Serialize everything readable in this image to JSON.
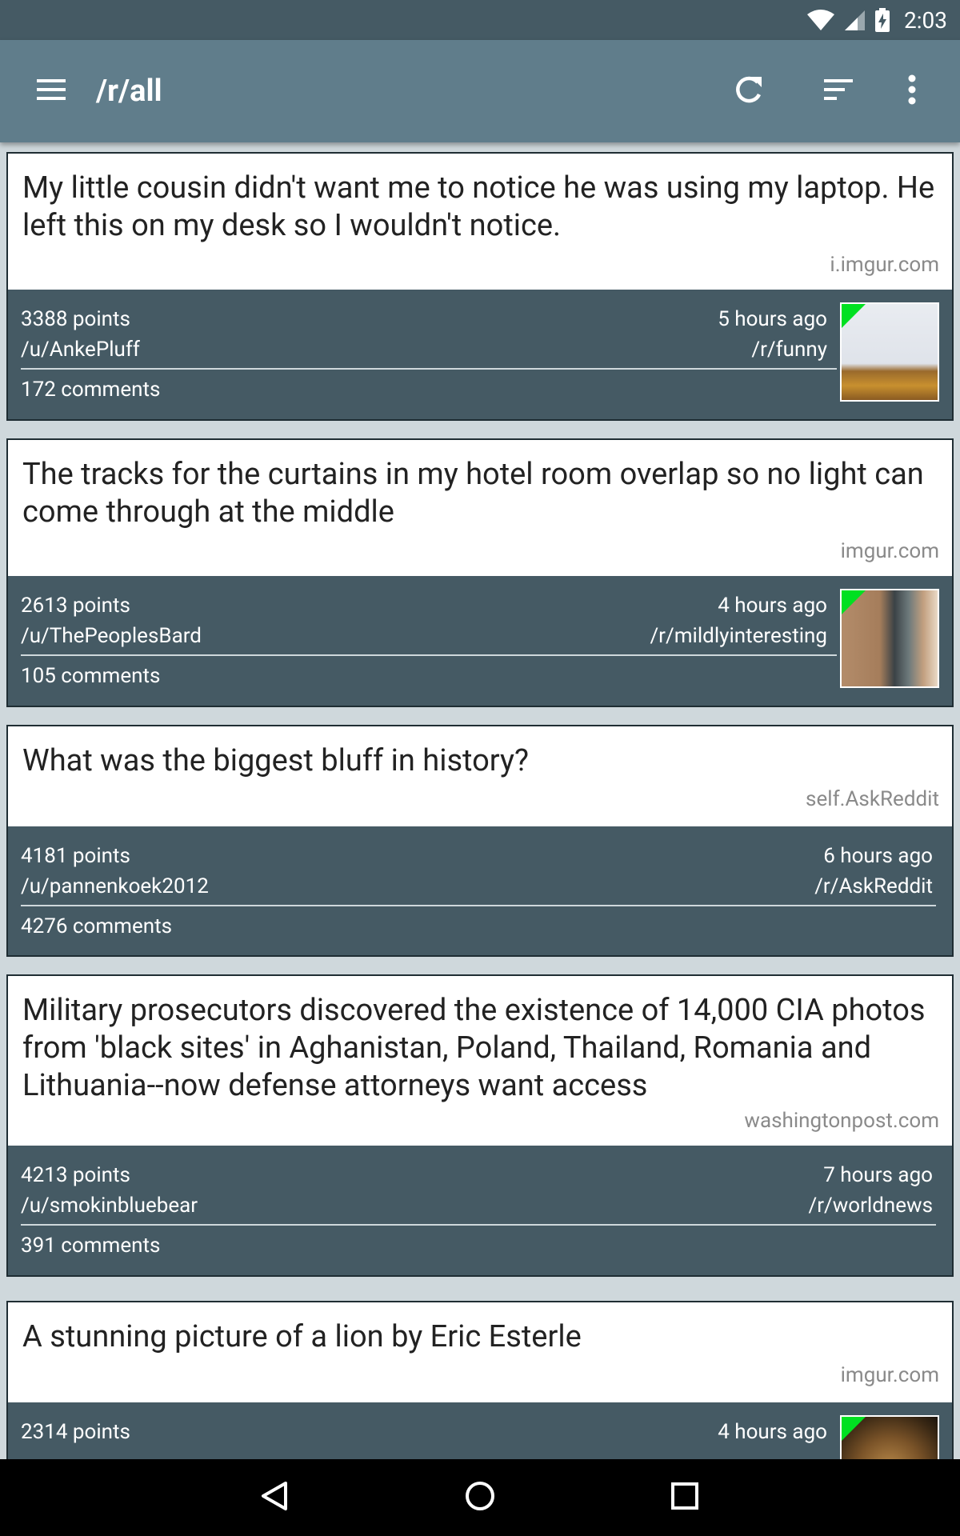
{
  "status_bar": {
    "time": "2:03"
  },
  "app_bar": {
    "title": "/r/all"
  },
  "colors": {
    "status_bar": "#455a64",
    "app_bar": "#607d8b",
    "card_footer": "#455a64",
    "thumbnail_flag": "#00e021"
  },
  "posts": [
    {
      "title": "My little cousin didn't want me to notice he was using my laptop. He left this on my desk so I wouldn't notice.",
      "domain": "i.imgur.com",
      "points": "3388 points",
      "author": "/u/AnkePluff",
      "age": "5 hours ago",
      "subreddit": "/r/funny",
      "comments": "172 comments"
    },
    {
      "title": "The tracks for the curtains in my hotel room overlap so no light can come through at the middle",
      "domain": "imgur.com",
      "points": "2613 points",
      "author": "/u/ThePeoplesBard",
      "age": "4 hours ago",
      "subreddit": "/r/mildlyinteresting",
      "comments": "105 comments"
    },
    {
      "title": "What was the biggest bluff in history?",
      "domain": "self.AskReddit",
      "points": "4181 points",
      "author": "/u/pannenkoek2012",
      "age": "6 hours ago",
      "subreddit": "/r/AskReddit",
      "comments": "4276 comments"
    },
    {
      "title": "Military prosecutors discovered the existence of 14,000 CIA photos from 'black sites' in Aghanistan, Poland, Thailand, Romania and Lithuania--now defense attorneys want access",
      "domain": "washingtonpost.com",
      "points": "4213 points",
      "author": "/u/smokinbluebear",
      "age": "7 hours ago",
      "subreddit": "/r/worldnews",
      "comments": "391 comments"
    },
    {
      "title": "A stunning picture of a lion by Eric Esterle",
      "domain": "imgur.com",
      "points": "2314 points",
      "age": "4 hours ago"
    }
  ]
}
